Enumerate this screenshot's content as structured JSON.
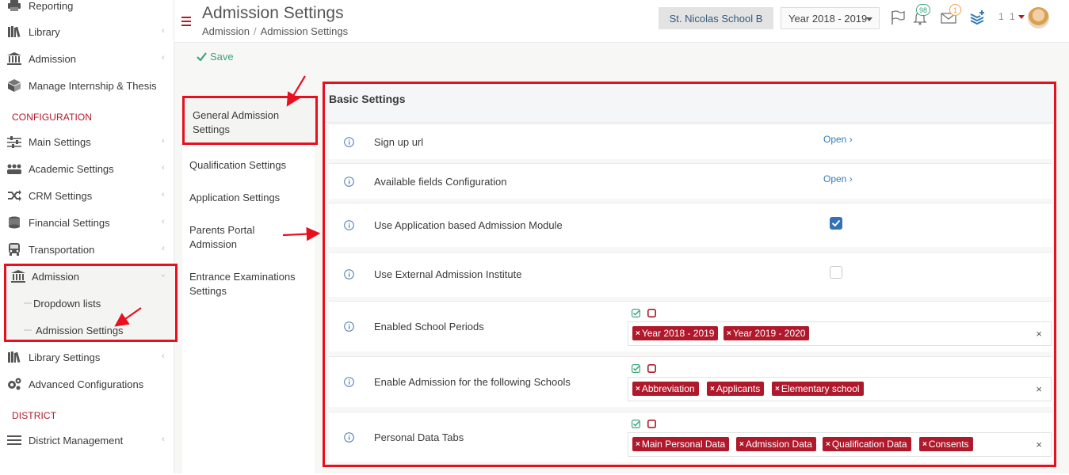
{
  "sidebar": {
    "items": [
      {
        "label": "Reporting",
        "icon": "printer-icon"
      },
      {
        "label": "Library",
        "icon": "books-icon"
      },
      {
        "label": "Admission",
        "icon": "bank-icon"
      },
      {
        "label": "Manage Internship & Thesis",
        "icon": "box-icon"
      },
      {
        "label": "Main Settings",
        "icon": "sliders-icon"
      },
      {
        "label": "Academic Settings",
        "icon": "people-icon"
      },
      {
        "label": "CRM Settings",
        "icon": "shuffle-icon"
      },
      {
        "label": "Financial Settings",
        "icon": "coins-icon"
      },
      {
        "label": "Transportation",
        "icon": "bus-icon"
      },
      {
        "label": "Admission",
        "icon": "bank-icon"
      },
      {
        "label": "Library Settings",
        "icon": "books-icon"
      },
      {
        "label": "Advanced Configurations",
        "icon": "gears-icon"
      },
      {
        "label": "District Management",
        "icon": "menu-icon"
      }
    ],
    "sections": {
      "configuration": "CONFIGURATION",
      "district": "DISTRICT"
    },
    "submenu": [
      {
        "label": "Dropdown lists"
      },
      {
        "label": "Admission Settings"
      }
    ]
  },
  "header": {
    "title": "Admission Settings",
    "breadcrumb": [
      "Admission",
      "Admission Settings"
    ],
    "school": "St. Nicolas School B",
    "year": "Year 2018 - 2019",
    "notifications_count": "98",
    "messages_count": "1",
    "user_text": "1 1"
  },
  "toolbar": {
    "save_label": "Save"
  },
  "left_nav": [
    "General Admission Settings",
    "Qualification Settings",
    "Application Settings",
    "Parents Portal Admission",
    "Entrance Examinations Settings"
  ],
  "panel": {
    "title": "Basic Settings",
    "rows": [
      {
        "label": "Sign up url",
        "action": "Open"
      },
      {
        "label": "Available fields Configuration",
        "action": "Open"
      },
      {
        "label": "Use Application based Admission Module",
        "checked": true
      },
      {
        "label": "Use External Admission Institute",
        "checked": false
      },
      {
        "label": "Enabled School Periods",
        "tags": [
          "Year 2018 - 2019",
          "Year 2019 - 2020"
        ]
      },
      {
        "label": "Enable Admission for the following Schools",
        "tags": [
          "Abbreviation",
          "Applicants",
          "Elementary school"
        ]
      },
      {
        "label": "Personal Data Tabs",
        "tags": [
          "Main Personal Data",
          "Admission Data",
          "Qualification Data",
          "Consents"
        ]
      }
    ]
  },
  "colors": {
    "accent": "#b0192b",
    "link": "#337ab7",
    "save": "#3aa57a",
    "annotation": "#e8101f"
  }
}
